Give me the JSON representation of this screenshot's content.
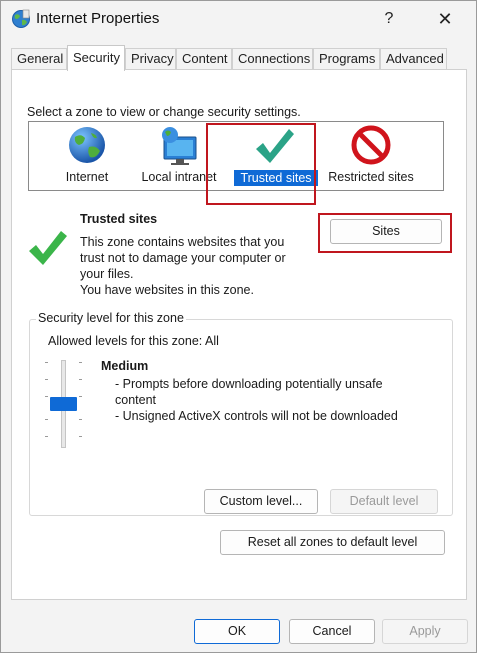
{
  "window": {
    "title": "Internet Properties",
    "help_label": "?",
    "close_label": "✕"
  },
  "tabs": [
    {
      "label": "General",
      "active": false
    },
    {
      "label": "Security",
      "active": true
    },
    {
      "label": "Privacy",
      "active": false
    },
    {
      "label": "Content",
      "active": false
    },
    {
      "label": "Connections",
      "active": false
    },
    {
      "label": "Programs",
      "active": false
    },
    {
      "label": "Advanced",
      "active": false
    }
  ],
  "security": {
    "zone_prompt": "Select a zone to view or change security settings.",
    "zones": [
      {
        "label": "Internet",
        "icon": "globe-icon"
      },
      {
        "label": "Local intranet",
        "icon": "intranet-icon"
      },
      {
        "label": "Trusted sites",
        "icon": "checkmark-icon",
        "selected": true
      },
      {
        "label": "Restricted sites",
        "icon": "restricted-icon"
      }
    ],
    "selected_zone": {
      "title": "Trusted sites",
      "desc_line1": "This zone contains websites that you",
      "desc_line2": "trust not to damage your computer or",
      "desc_line3": "your files.",
      "desc_line4": "You have websites in this zone.",
      "sites_button": "Sites"
    },
    "level_group": {
      "title": "Security level for this zone",
      "allowed": "Allowed levels for this zone: All",
      "level_name": "Medium",
      "bullet1_line1": "- Prompts before downloading potentially unsafe",
      "bullet1_line2": "content",
      "bullet2": "- Unsigned ActiveX controls will not be downloaded",
      "custom_button": "Custom level...",
      "default_button": "Default level",
      "level_value": 0.5
    },
    "reset_button": "Reset all zones to default level"
  },
  "footer": {
    "ok": "OK",
    "cancel": "Cancel",
    "apply": "Apply"
  },
  "colors": {
    "accent": "#0f6ad6",
    "highlight_box": "#c0161e",
    "check_green": "#3bb54a"
  }
}
